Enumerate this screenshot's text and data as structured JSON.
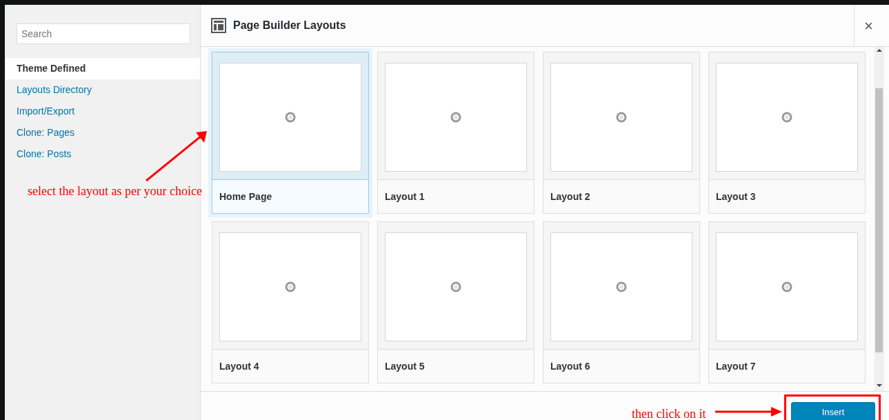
{
  "sidebar": {
    "search": {
      "placeholder": "Search"
    },
    "items": [
      {
        "label": "Theme Defined",
        "selected": true
      },
      {
        "label": "Layouts Directory",
        "selected": false
      },
      {
        "label": "Import/Export",
        "selected": false
      },
      {
        "label": "Clone: Pages",
        "selected": false
      },
      {
        "label": "Clone: Posts",
        "selected": false
      }
    ]
  },
  "dialog": {
    "title": "Page Builder Layouts",
    "close": "×"
  },
  "layouts": [
    {
      "name": "Home Page",
      "selected": true
    },
    {
      "name": "Layout 1",
      "selected": false
    },
    {
      "name": "Layout 2",
      "selected": false
    },
    {
      "name": "Layout 3",
      "selected": false
    },
    {
      "name": "Layout 4",
      "selected": false
    },
    {
      "name": "Layout 5",
      "selected": false
    },
    {
      "name": "Layout 6",
      "selected": false
    },
    {
      "name": "Layout 7",
      "selected": false
    }
  ],
  "footer": {
    "button": "Insert"
  },
  "annotations": [
    {
      "text": "select the layout as per your choice"
    },
    {
      "text": "then click on it"
    }
  ]
}
